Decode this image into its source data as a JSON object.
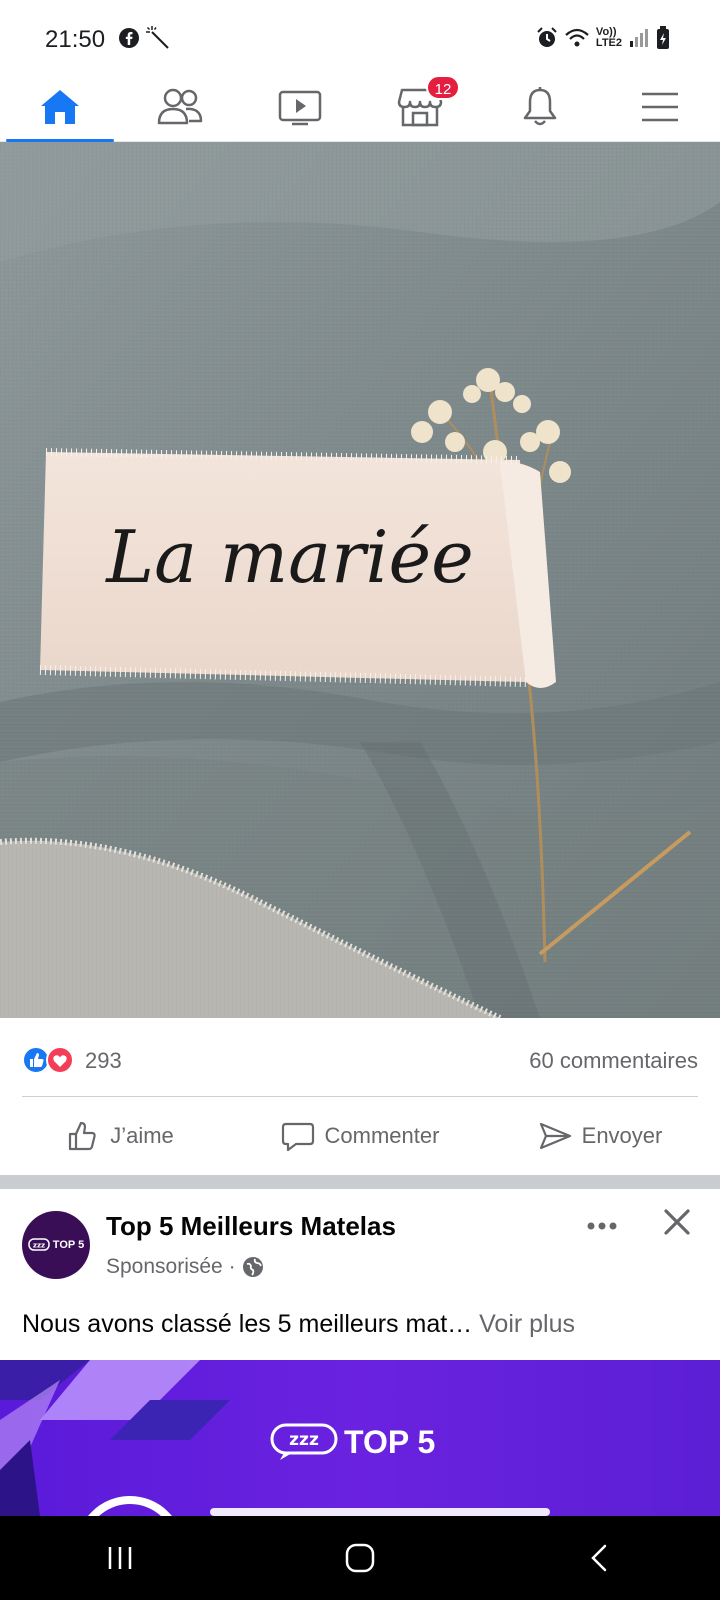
{
  "status_bar": {
    "time": "21:50",
    "network_top": "Vo))",
    "network_bottom": "LTE2"
  },
  "topnav": {
    "items": [
      {
        "name": "home",
        "icon": "home-icon",
        "active": true
      },
      {
        "name": "friends",
        "icon": "friends-icon"
      },
      {
        "name": "video",
        "icon": "video-icon"
      },
      {
        "name": "marketplace",
        "icon": "marketplace-icon",
        "badge": "12"
      },
      {
        "name": "notifications",
        "icon": "bell-icon"
      },
      {
        "name": "menu",
        "icon": "hamburger-menu-icon"
      }
    ],
    "accent": "#1877f2"
  },
  "post": {
    "image_text": "La mariée",
    "reaction_count": "293",
    "comments_count": "60 commentaires",
    "actions": {
      "like": "J’aime",
      "comment": "Commenter",
      "send": "Envoyer"
    }
  },
  "sponsored": {
    "avatar_text": "TOP 5",
    "page_name": "Top 5 Meilleurs Matelas",
    "meta": "Sponsorisée ·",
    "text": "Nous avons classé les 5 meilleurs mat…",
    "see_more": "Voir plus",
    "banner_logo": "TOP 5",
    "banner_logo_badge": "zzz"
  },
  "colors": {
    "like_blue": "#1877f2",
    "love_red": "#f33e58",
    "badge_red": "#e41e3f",
    "ad_purple": "#5a1ad9"
  }
}
